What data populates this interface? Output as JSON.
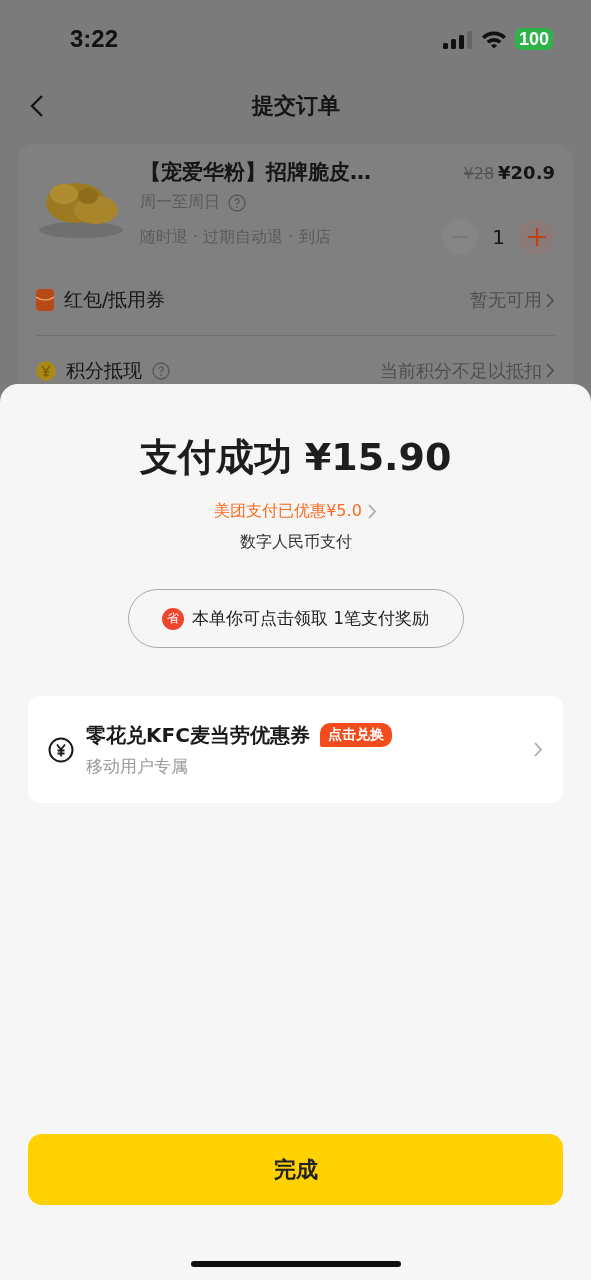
{
  "status_bar": {
    "time": "3:22",
    "battery": "100"
  },
  "nav": {
    "title": "提交订单"
  },
  "order": {
    "product": {
      "kind": "picture",
      "title": "【宠爱华粉】招牌脆皮…",
      "original_price": "¥28",
      "price": "¥20.9",
      "schedule": "周一至周日",
      "terms": "随时退 · 过期自动退 · 到店",
      "quantity": "1"
    },
    "rows": [
      {
        "label": "红包/抵用券",
        "value": "暂无可用",
        "help": false
      },
      {
        "label": "积分抵现",
        "value": "当前积分不足以抵扣",
        "help": true
      }
    ]
  },
  "sheet": {
    "title": "支付成功 ¥15.90",
    "discount": "美团支付已优惠¥5.0",
    "method": "数字人民币支付",
    "reward": {
      "badge": "省",
      "text": "本单你可点击领取 1笔支付奖励"
    },
    "offer": {
      "title": "零花兑KFC麦当劳优惠券",
      "tag": "点击兑换",
      "subtitle": "移动用户专属"
    },
    "done_button": "完成"
  }
}
